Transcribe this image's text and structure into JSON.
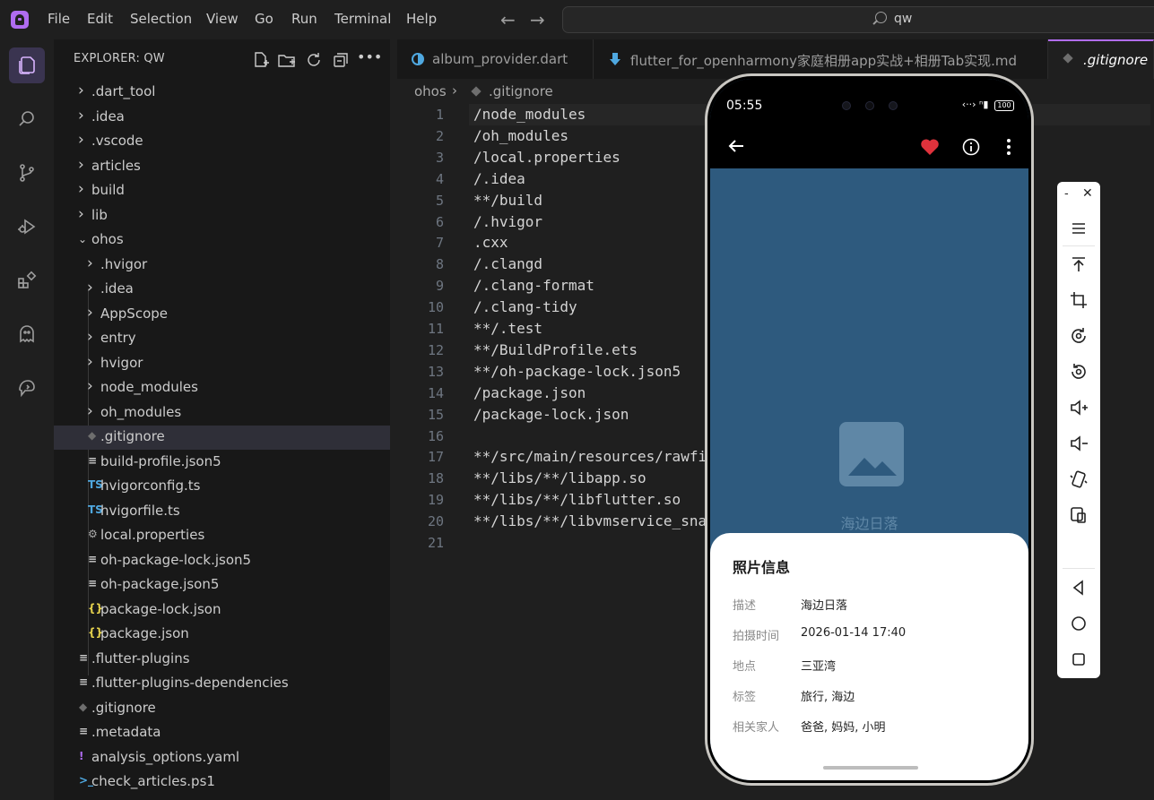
{
  "menu": [
    "File",
    "Edit",
    "Selection",
    "View",
    "Go",
    "Run",
    "Terminal",
    "Help"
  ],
  "search": {
    "text": "qw"
  },
  "activity": [
    {
      "name": "explorer-icon"
    },
    {
      "name": "search-icon"
    },
    {
      "name": "source-control-icon"
    },
    {
      "name": "run-debug-icon"
    },
    {
      "name": "extensions-icon"
    },
    {
      "name": "ghost-icon"
    },
    {
      "name": "copilot-icon"
    }
  ],
  "explorer": {
    "title": "EXPLORER: QW",
    "items": [
      {
        "label": ".dart_tool",
        "type": "folder",
        "depth": 0,
        "expanded": false
      },
      {
        "label": ".idea",
        "type": "folder",
        "depth": 0,
        "expanded": false
      },
      {
        "label": ".vscode",
        "type": "folder",
        "depth": 0,
        "expanded": false
      },
      {
        "label": "articles",
        "type": "folder",
        "depth": 0,
        "expanded": false
      },
      {
        "label": "build",
        "type": "folder",
        "depth": 0,
        "expanded": false
      },
      {
        "label": "lib",
        "type": "folder",
        "depth": 0,
        "expanded": false
      },
      {
        "label": "ohos",
        "type": "folder",
        "depth": 0,
        "expanded": true
      },
      {
        "label": ".hvigor",
        "type": "folder",
        "depth": 1,
        "expanded": false
      },
      {
        "label": ".idea",
        "type": "folder",
        "depth": 1,
        "expanded": false
      },
      {
        "label": "AppScope",
        "type": "folder",
        "depth": 1,
        "expanded": false
      },
      {
        "label": "entry",
        "type": "folder",
        "depth": 1,
        "expanded": false
      },
      {
        "label": "hvigor",
        "type": "folder",
        "depth": 1,
        "expanded": false
      },
      {
        "label": "node_modules",
        "type": "folder",
        "depth": 1,
        "expanded": false
      },
      {
        "label": "oh_modules",
        "type": "folder",
        "depth": 1,
        "expanded": false
      },
      {
        "label": ".gitignore",
        "type": "git",
        "depth": 1,
        "selected": true
      },
      {
        "label": "build-profile.json5",
        "type": "lines",
        "depth": 1
      },
      {
        "label": "hvigorconfig.ts",
        "type": "ts",
        "depth": 1
      },
      {
        "label": "hvigorfile.ts",
        "type": "ts",
        "depth": 1
      },
      {
        "label": "local.properties",
        "type": "gear",
        "depth": 1
      },
      {
        "label": "oh-package-lock.json5",
        "type": "lines",
        "depth": 1
      },
      {
        "label": "oh-package.json5",
        "type": "lines",
        "depth": 1
      },
      {
        "label": "package-lock.json",
        "type": "json",
        "depth": 1
      },
      {
        "label": "package.json",
        "type": "json",
        "depth": 1
      },
      {
        "label": ".flutter-plugins",
        "type": "lines",
        "depth": 0
      },
      {
        "label": ".flutter-plugins-dependencies",
        "type": "lines",
        "depth": 0
      },
      {
        "label": ".gitignore",
        "type": "git",
        "depth": 0
      },
      {
        "label": ".metadata",
        "type": "lines",
        "depth": 0
      },
      {
        "label": "analysis_options.yaml",
        "type": "yaml",
        "depth": 0
      },
      {
        "label": "check_articles.ps1",
        "type": "ps",
        "depth": 0
      }
    ]
  },
  "tabs": [
    {
      "label": "album_provider.dart",
      "active": false
    },
    {
      "label": "flutter_for_openharmony家庭相册app实战+相册Tab实现.md",
      "active": false
    },
    {
      "label": ".gitignore",
      "active": true
    }
  ],
  "breadcrumb": {
    "folder": "ohos",
    "sep": "›",
    "file": ".gitignore"
  },
  "code": [
    {
      "n": "1",
      "t": "/node_modules"
    },
    {
      "n": "2",
      "t": "/oh_modules"
    },
    {
      "n": "3",
      "t": "/local.properties"
    },
    {
      "n": "4",
      "t": "/.idea"
    },
    {
      "n": "5",
      "t": "**/build"
    },
    {
      "n": "6",
      "t": "/.hvigor"
    },
    {
      "n": "7",
      "t": ".cxx"
    },
    {
      "n": "8",
      "t": "/.clangd"
    },
    {
      "n": "9",
      "t": "/.clang-format"
    },
    {
      "n": "10",
      "t": "/.clang-tidy"
    },
    {
      "n": "11",
      "t": "**/.test"
    },
    {
      "n": "12",
      "t": "**/BuildProfile.ets"
    },
    {
      "n": "13",
      "t": "**/oh-package-lock.json5"
    },
    {
      "n": "14",
      "t": "/package.json"
    },
    {
      "n": "15",
      "t": "/package-lock.json"
    },
    {
      "n": "16",
      "t": ""
    },
    {
      "n": "17",
      "t": "**/src/main/resources/rawfi"
    },
    {
      "n": "18",
      "t": "**/libs/**/libapp.so"
    },
    {
      "n": "19",
      "t": "**/libs/**/libflutter.so"
    },
    {
      "n": "20",
      "t": "**/libs/**/libvmservice_sna"
    },
    {
      "n": "21",
      "t": ""
    }
  ],
  "phone": {
    "time": "05:55",
    "battery": "100",
    "photo_caption": "海边日落",
    "sheet": {
      "title": "照片信息",
      "rows": [
        {
          "key": "描述",
          "value": "海边日落"
        },
        {
          "key": "拍摄时间",
          "value": "2026-01-14 17:40"
        },
        {
          "key": "地点",
          "value": "三亚湾"
        },
        {
          "key": "标签",
          "value": "旅行, 海边"
        },
        {
          "key": "相关家人",
          "value": "爸爸, 妈妈, 小明"
        }
      ]
    }
  },
  "toolbar": {
    "minimize": "-",
    "close": "✕"
  },
  "colors": {
    "accent": "#b06cf0",
    "photo_bg": "#2e5a7e",
    "heart": "#e0323c"
  }
}
